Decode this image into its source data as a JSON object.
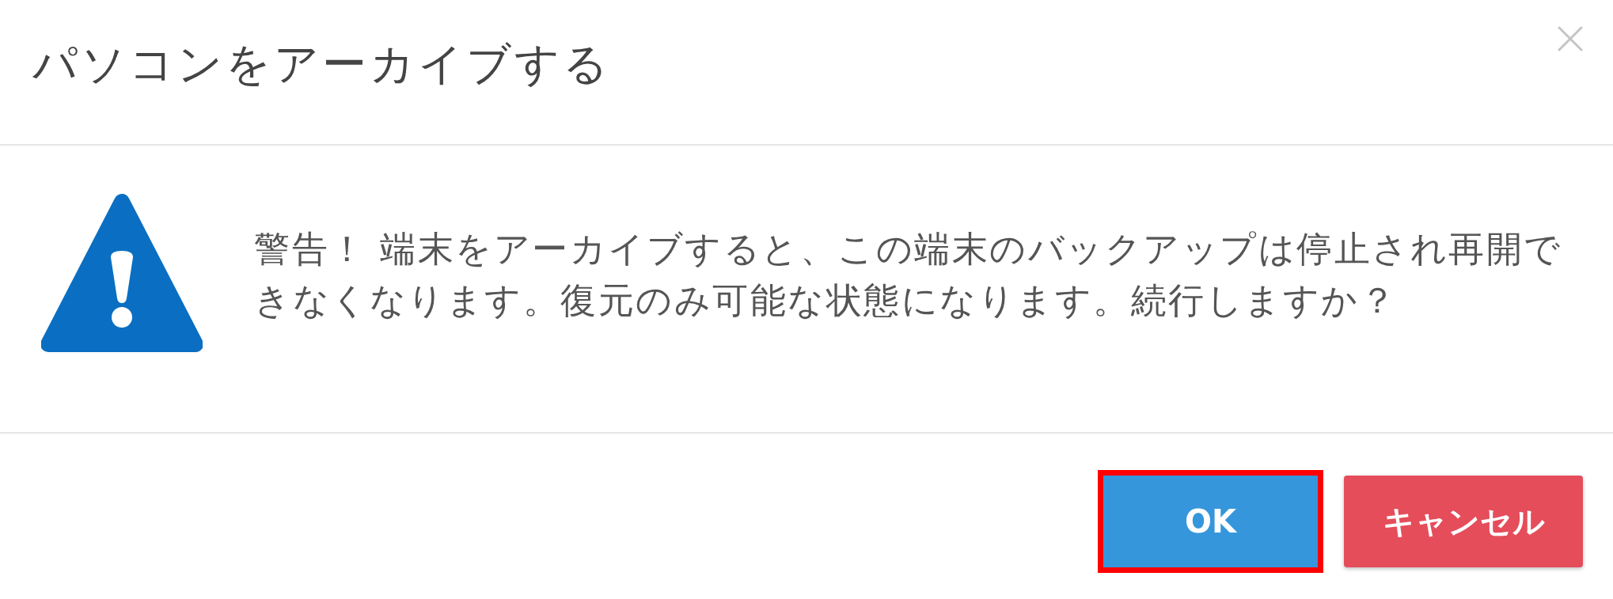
{
  "dialog": {
    "title": "パソコンをアーカイブする",
    "message": "警告！ 端末をアーカイブすると、この端末のバックアップは停止され再開できなくなります。復元のみ可能な状態になります。続行しますか？",
    "buttons": [
      {
        "label": "OK",
        "kind": "primary",
        "highlighted": true
      },
      {
        "label": "キャンセル",
        "kind": "danger",
        "highlighted": false
      }
    ]
  }
}
